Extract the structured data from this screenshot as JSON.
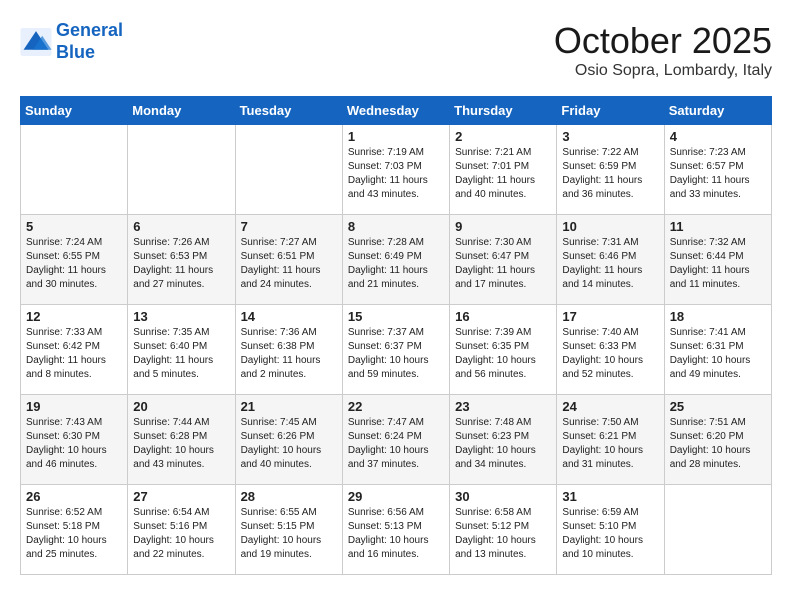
{
  "header": {
    "logo_line1": "General",
    "logo_line2": "Blue",
    "month_title": "October 2025",
    "location": "Osio Sopra, Lombardy, Italy"
  },
  "calendar": {
    "days_of_week": [
      "Sunday",
      "Monday",
      "Tuesday",
      "Wednesday",
      "Thursday",
      "Friday",
      "Saturday"
    ],
    "weeks": [
      [
        {
          "day": "",
          "info": ""
        },
        {
          "day": "",
          "info": ""
        },
        {
          "day": "",
          "info": ""
        },
        {
          "day": "1",
          "info": "Sunrise: 7:19 AM\nSunset: 7:03 PM\nDaylight: 11 hours and 43 minutes."
        },
        {
          "day": "2",
          "info": "Sunrise: 7:21 AM\nSunset: 7:01 PM\nDaylight: 11 hours and 40 minutes."
        },
        {
          "day": "3",
          "info": "Sunrise: 7:22 AM\nSunset: 6:59 PM\nDaylight: 11 hours and 36 minutes."
        },
        {
          "day": "4",
          "info": "Sunrise: 7:23 AM\nSunset: 6:57 PM\nDaylight: 11 hours and 33 minutes."
        }
      ],
      [
        {
          "day": "5",
          "info": "Sunrise: 7:24 AM\nSunset: 6:55 PM\nDaylight: 11 hours and 30 minutes."
        },
        {
          "day": "6",
          "info": "Sunrise: 7:26 AM\nSunset: 6:53 PM\nDaylight: 11 hours and 27 minutes."
        },
        {
          "day": "7",
          "info": "Sunrise: 7:27 AM\nSunset: 6:51 PM\nDaylight: 11 hours and 24 minutes."
        },
        {
          "day": "8",
          "info": "Sunrise: 7:28 AM\nSunset: 6:49 PM\nDaylight: 11 hours and 21 minutes."
        },
        {
          "day": "9",
          "info": "Sunrise: 7:30 AM\nSunset: 6:47 PM\nDaylight: 11 hours and 17 minutes."
        },
        {
          "day": "10",
          "info": "Sunrise: 7:31 AM\nSunset: 6:46 PM\nDaylight: 11 hours and 14 minutes."
        },
        {
          "day": "11",
          "info": "Sunrise: 7:32 AM\nSunset: 6:44 PM\nDaylight: 11 hours and 11 minutes."
        }
      ],
      [
        {
          "day": "12",
          "info": "Sunrise: 7:33 AM\nSunset: 6:42 PM\nDaylight: 11 hours and 8 minutes."
        },
        {
          "day": "13",
          "info": "Sunrise: 7:35 AM\nSunset: 6:40 PM\nDaylight: 11 hours and 5 minutes."
        },
        {
          "day": "14",
          "info": "Sunrise: 7:36 AM\nSunset: 6:38 PM\nDaylight: 11 hours and 2 minutes."
        },
        {
          "day": "15",
          "info": "Sunrise: 7:37 AM\nSunset: 6:37 PM\nDaylight: 10 hours and 59 minutes."
        },
        {
          "day": "16",
          "info": "Sunrise: 7:39 AM\nSunset: 6:35 PM\nDaylight: 10 hours and 56 minutes."
        },
        {
          "day": "17",
          "info": "Sunrise: 7:40 AM\nSunset: 6:33 PM\nDaylight: 10 hours and 52 minutes."
        },
        {
          "day": "18",
          "info": "Sunrise: 7:41 AM\nSunset: 6:31 PM\nDaylight: 10 hours and 49 minutes."
        }
      ],
      [
        {
          "day": "19",
          "info": "Sunrise: 7:43 AM\nSunset: 6:30 PM\nDaylight: 10 hours and 46 minutes."
        },
        {
          "day": "20",
          "info": "Sunrise: 7:44 AM\nSunset: 6:28 PM\nDaylight: 10 hours and 43 minutes."
        },
        {
          "day": "21",
          "info": "Sunrise: 7:45 AM\nSunset: 6:26 PM\nDaylight: 10 hours and 40 minutes."
        },
        {
          "day": "22",
          "info": "Sunrise: 7:47 AM\nSunset: 6:24 PM\nDaylight: 10 hours and 37 minutes."
        },
        {
          "day": "23",
          "info": "Sunrise: 7:48 AM\nSunset: 6:23 PM\nDaylight: 10 hours and 34 minutes."
        },
        {
          "day": "24",
          "info": "Sunrise: 7:50 AM\nSunset: 6:21 PM\nDaylight: 10 hours and 31 minutes."
        },
        {
          "day": "25",
          "info": "Sunrise: 7:51 AM\nSunset: 6:20 PM\nDaylight: 10 hours and 28 minutes."
        }
      ],
      [
        {
          "day": "26",
          "info": "Sunrise: 6:52 AM\nSunset: 5:18 PM\nDaylight: 10 hours and 25 minutes."
        },
        {
          "day": "27",
          "info": "Sunrise: 6:54 AM\nSunset: 5:16 PM\nDaylight: 10 hours and 22 minutes."
        },
        {
          "day": "28",
          "info": "Sunrise: 6:55 AM\nSunset: 5:15 PM\nDaylight: 10 hours and 19 minutes."
        },
        {
          "day": "29",
          "info": "Sunrise: 6:56 AM\nSunset: 5:13 PM\nDaylight: 10 hours and 16 minutes."
        },
        {
          "day": "30",
          "info": "Sunrise: 6:58 AM\nSunset: 5:12 PM\nDaylight: 10 hours and 13 minutes."
        },
        {
          "day": "31",
          "info": "Sunrise: 6:59 AM\nSunset: 5:10 PM\nDaylight: 10 hours and 10 minutes."
        },
        {
          "day": "",
          "info": ""
        }
      ]
    ]
  }
}
